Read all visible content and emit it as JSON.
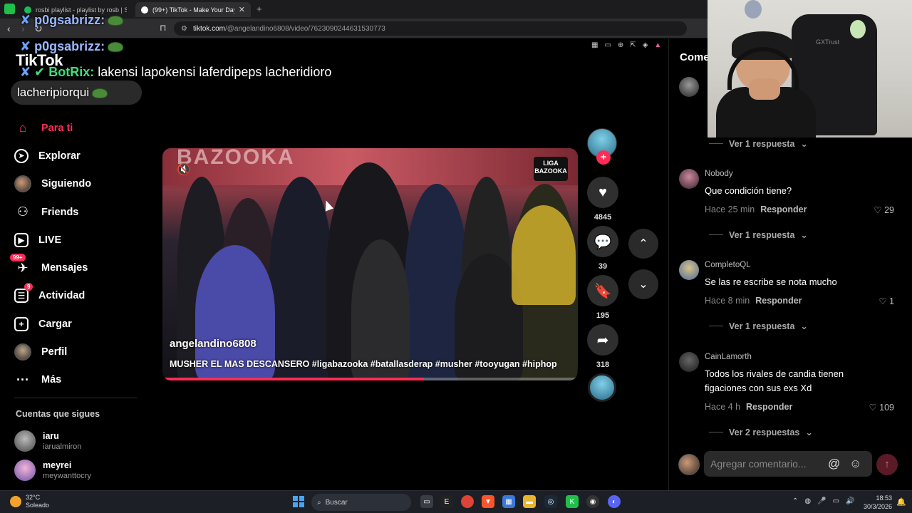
{
  "browser": {
    "tabs": [
      {
        "label": "rosbi playlist - playlist by rosb | Spoti",
        "active": false
      },
      {
        "label": "(99+) TikTok - Make Your Day",
        "active": true
      }
    ],
    "url_host": "tiktok.com",
    "url_path": "/@angelandino6808/video/7623090244631530773"
  },
  "stream_chat": [
    {
      "user": "p0gsabrizz:",
      "message": ""
    },
    {
      "user": "p0gsabrizz:",
      "message": ""
    },
    {
      "user": "BotRix:",
      "message": "lakensi lapokensi laferdipeps lacheridioro"
    },
    {
      "user": "",
      "message": "lacheripiorqui"
    }
  ],
  "tiktok": {
    "logo": "TikTok",
    "nav": [
      {
        "label": "Para ti",
        "icon": "home-icon",
        "active": true
      },
      {
        "label": "Explorar",
        "icon": "compass-icon"
      },
      {
        "label": "Siguiendo",
        "icon": "following-avatar-icon"
      },
      {
        "label": "Friends",
        "icon": "friends-icon"
      },
      {
        "label": "LIVE",
        "icon": "live-tv-icon"
      },
      {
        "label": "Mensajes",
        "icon": "messages-icon",
        "badge": "99+"
      },
      {
        "label": "Actividad",
        "icon": "activity-icon",
        "badge": "9"
      },
      {
        "label": "Cargar",
        "icon": "upload-icon"
      },
      {
        "label": "Perfil",
        "icon": "profile-avatar-icon"
      },
      {
        "label": "Más",
        "icon": "more-icon"
      }
    ],
    "following_title": "Cuentas que sigues",
    "following": [
      {
        "name": "iaru",
        "handle": "iarualmiron"
      },
      {
        "name": "meyrei",
        "handle": "meywanttocry"
      }
    ]
  },
  "video": {
    "author": "angelandino6808",
    "description": "MUSHER EL MAS DESCANSERO #ligabazooka #batallasderap #musher #tooyugan  #hiphop",
    "banner_text": "BAZOOKA",
    "logo_text": "LIGA BAZOOKA",
    "progress_fraction": 0.63,
    "likes": "4845",
    "comments": "39",
    "saves": "195",
    "shares": "318"
  },
  "comments_panel": {
    "title": "Come",
    "partial_first": "s",
    "items": [
      {
        "user": "Nobody",
        "text": "Que condición tiene?",
        "time": "Hace 25 min",
        "likes": "29",
        "replies": "Ver 1 respuesta"
      },
      {
        "user": "CompletoQL",
        "text": "Se las re escribe se nota mucho",
        "time": "Hace 8 min",
        "likes": "1",
        "replies": "Ver 1 respuesta"
      },
      {
        "user": "CainLamorth",
        "text": "Todos los rivales de candia tienen figaciones con sus exs Xd",
        "time": "Hace 4 h",
        "likes": "109",
        "replies": "Ver 2 respuestas"
      }
    ],
    "first_replies": "Ver 1 respuesta",
    "reply_label": "Responder",
    "input_placeholder": "Agregar comentario..."
  },
  "webcam": {
    "chair_brand": "GXTrust"
  },
  "taskbar": {
    "temp": "32°C",
    "weather": "Soleado",
    "search": "Buscar",
    "time": "18:53",
    "date": "30/3/2026"
  },
  "colors": {
    "accent": "#fe2c55",
    "background": "#000000"
  }
}
